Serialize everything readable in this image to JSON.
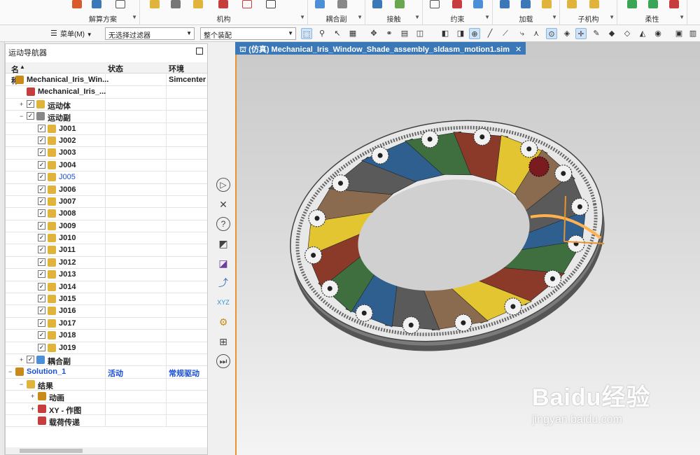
{
  "ribbon": {
    "groups": [
      {
        "label": "解算方案"
      },
      {
        "label": "机构"
      },
      {
        "label": "耦合副"
      },
      {
        "label": "接触"
      },
      {
        "label": "约束"
      },
      {
        "label": "加载"
      },
      {
        "label": "子机构"
      },
      {
        "label": "柔性"
      }
    ]
  },
  "toolbar": {
    "menu_label": "菜单(M)",
    "filter_value": "无选择过滤器",
    "assembly_value": "整个装配"
  },
  "navigator": {
    "title": "运动导航器",
    "columns": {
      "name": "名称",
      "status": "状态",
      "env": "环境"
    },
    "rows": [
      {
        "name": "Mechanical_Iris_Win...",
        "status": "",
        "env": "Simcenter",
        "indent": 0,
        "expander": "",
        "checkbox": false,
        "icon": "sim-icon"
      },
      {
        "name": "Mechanical_Iris_...",
        "status": "",
        "env": "",
        "indent": 1,
        "expander": "",
        "checkbox": false,
        "icon": "assembly-icon"
      },
      {
        "name": "运动体",
        "status": "",
        "env": "",
        "indent": 1,
        "expander": "+",
        "checkbox": true,
        "icon": "link-icon"
      },
      {
        "name": "运动副",
        "status": "",
        "env": "",
        "indent": 1,
        "expander": "−",
        "checkbox": true,
        "icon": "joint-group-icon"
      },
      {
        "name": "J001",
        "status": "",
        "env": "",
        "indent": 2,
        "expander": "",
        "checkbox": true,
        "icon": "joint-icon"
      },
      {
        "name": "J002",
        "status": "",
        "env": "",
        "indent": 2,
        "expander": "",
        "checkbox": true,
        "icon": "joint-icon"
      },
      {
        "name": "J003",
        "status": "",
        "env": "",
        "indent": 2,
        "expander": "",
        "checkbox": true,
        "icon": "joint-icon"
      },
      {
        "name": "J004",
        "status": "",
        "env": "",
        "indent": 2,
        "expander": "",
        "checkbox": true,
        "icon": "joint-icon"
      },
      {
        "name": "J005",
        "status": "",
        "env": "",
        "indent": 2,
        "expander": "",
        "checkbox": true,
        "icon": "joint-icon",
        "highlight": true
      },
      {
        "name": "J006",
        "status": "",
        "env": "",
        "indent": 2,
        "expander": "",
        "checkbox": true,
        "icon": "joint-icon"
      },
      {
        "name": "J007",
        "status": "",
        "env": "",
        "indent": 2,
        "expander": "",
        "checkbox": true,
        "icon": "joint-icon"
      },
      {
        "name": "J008",
        "status": "",
        "env": "",
        "indent": 2,
        "expander": "",
        "checkbox": true,
        "icon": "joint-icon"
      },
      {
        "name": "J009",
        "status": "",
        "env": "",
        "indent": 2,
        "expander": "",
        "checkbox": true,
        "icon": "joint-icon"
      },
      {
        "name": "J010",
        "status": "",
        "env": "",
        "indent": 2,
        "expander": "",
        "checkbox": true,
        "icon": "joint-icon"
      },
      {
        "name": "J011",
        "status": "",
        "env": "",
        "indent": 2,
        "expander": "",
        "checkbox": true,
        "icon": "joint-icon"
      },
      {
        "name": "J012",
        "status": "",
        "env": "",
        "indent": 2,
        "expander": "",
        "checkbox": true,
        "icon": "joint-icon"
      },
      {
        "name": "J013",
        "status": "",
        "env": "",
        "indent": 2,
        "expander": "",
        "checkbox": true,
        "icon": "joint-icon"
      },
      {
        "name": "J014",
        "status": "",
        "env": "",
        "indent": 2,
        "expander": "",
        "checkbox": true,
        "icon": "joint-icon"
      },
      {
        "name": "J015",
        "status": "",
        "env": "",
        "indent": 2,
        "expander": "",
        "checkbox": true,
        "icon": "joint-icon"
      },
      {
        "name": "J016",
        "status": "",
        "env": "",
        "indent": 2,
        "expander": "",
        "checkbox": true,
        "icon": "joint-icon"
      },
      {
        "name": "J017",
        "status": "",
        "env": "",
        "indent": 2,
        "expander": "",
        "checkbox": true,
        "icon": "joint-icon"
      },
      {
        "name": "J018",
        "status": "",
        "env": "",
        "indent": 2,
        "expander": "",
        "checkbox": true,
        "icon": "joint-icon"
      },
      {
        "name": "J019",
        "status": "",
        "env": "",
        "indent": 2,
        "expander": "",
        "checkbox": true,
        "icon": "joint-icon"
      },
      {
        "name": "耦合副",
        "status": "",
        "env": "",
        "indent": 1,
        "expander": "+",
        "checkbox": true,
        "icon": "coupler-icon"
      },
      {
        "name": "Solution_1",
        "status": "活动",
        "env": "常规驱动",
        "indent": 0,
        "expander": "−",
        "checkbox": false,
        "icon": "solution-icon",
        "blue": true
      },
      {
        "name": "结果",
        "status": "",
        "env": "",
        "indent": 1,
        "expander": "−",
        "checkbox": false,
        "icon": "results-icon"
      },
      {
        "name": "动画",
        "status": "",
        "env": "",
        "indent": 2,
        "expander": "+",
        "checkbox": false,
        "icon": "animation-icon"
      },
      {
        "name": "XY - 作图",
        "status": "",
        "env": "",
        "indent": 2,
        "expander": "+",
        "checkbox": false,
        "icon": "xy-plot-icon"
      },
      {
        "name": "载荷传递",
        "status": "",
        "env": "",
        "indent": 2,
        "expander": "",
        "checkbox": false,
        "icon": "load-transfer-icon"
      }
    ]
  },
  "viewport": {
    "tab_title": "(仿真) Mechanical_Iris_Window_Shade_assembly_sldasm_motion1.sim",
    "tab_close": "✕"
  },
  "watermark": {
    "main": "Baidu经验",
    "sub": "jingyan.baidu.com"
  },
  "colors": {
    "tab_blue": "#3b78b7",
    "viewport_border": "#e8932f",
    "highlight_blue": "#1a4fd6",
    "blade_colors": [
      "#2f5f8f",
      "#3f6f3f",
      "#8b3a2a",
      "#e2c531",
      "#8a6b4f",
      "#5a5a5a"
    ]
  }
}
